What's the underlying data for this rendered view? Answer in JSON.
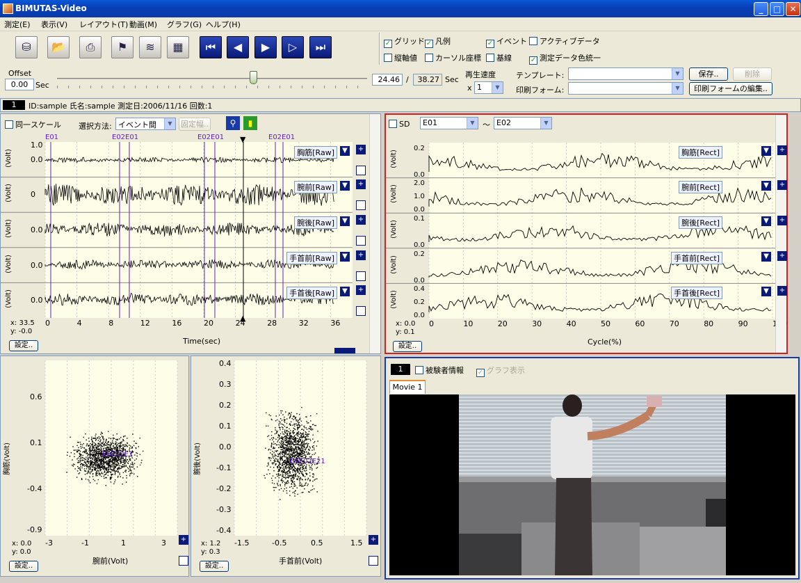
{
  "window": {
    "title": "BIMUTAS-Video",
    "min": "_",
    "max": "□",
    "close": "✕"
  },
  "menu": [
    "測定(E)",
    "表示(V)",
    "レイアウト(T)",
    "動画(M)",
    "グラフ(G)",
    "ヘルプ(H)"
  ],
  "toolbar": {
    "checks": [
      {
        "label": "グリッド",
        "checked": true
      },
      {
        "label": "凡例",
        "checked": true
      },
      {
        "label": "イベント",
        "checked": true
      },
      {
        "label": "アクティブデータ",
        "checked": false
      },
      {
        "label": "縦軸値",
        "checked": false
      },
      {
        "label": "カーソル座標",
        "checked": false
      },
      {
        "label": "基線",
        "checked": false
      },
      {
        "label": "測定データ色統一",
        "checked": true
      }
    ]
  },
  "offset": {
    "label": "Offset",
    "value": "0.00",
    "unit": "Sec",
    "current": "24.46",
    "slash": "/",
    "total": "38.27",
    "unit2": "Sec",
    "speed_label": "再生速度",
    "speed_x": "x",
    "speed_value": "1",
    "template_label": "テンプレート:",
    "print_label": "印刷フォーム:",
    "save": "保存..",
    "delete": "削除",
    "edit_print": "印刷フォームの編集.."
  },
  "info": {
    "num": "1",
    "text": "ID:sample 氏名:sample 測定日:2006/11/16 回数:1"
  },
  "left": {
    "same_scale": "同一スケール",
    "select_label": "選択方法:",
    "select_value": "イベント間",
    "fixed_width": "固定幅..",
    "events": [
      "E01",
      "E02E01",
      "E02E01",
      "E02E01"
    ],
    "channels": [
      {
        "tag": "胸筋[Raw]",
        "ytop": "1.0",
        "ymid": "0.0"
      },
      {
        "tag": "腕前[Raw]",
        "ytop": "",
        "ymid": "0"
      },
      {
        "tag": "腕後[Raw]",
        "ytop": "",
        "ymid": "0.0"
      },
      {
        "tag": "手首前[Raw]",
        "ytop": "",
        "ymid": "0.0"
      },
      {
        "tag": "手首後[Raw]",
        "ytop": "",
        "ymid": "0.0"
      }
    ],
    "unit": "(Volt)",
    "xticks": [
      "0",
      "4",
      "8",
      "12",
      "16",
      "20",
      "24",
      "28",
      "32",
      "36"
    ],
    "xlabel": "Time(sec)",
    "x": "x:  33.5",
    "y": "y:  -0.0",
    "settings": "設定.."
  },
  "right": {
    "sd": "SD",
    "from": "E01",
    "tilde": "〜",
    "to": "E02",
    "channels": [
      {
        "tag": "胸筋[Rect]",
        "ticks": [
          "0.2",
          "0.0"
        ]
      },
      {
        "tag": "腕前[Rect]",
        "ticks": [
          "2.0",
          "1.0",
          "0.0"
        ]
      },
      {
        "tag": "腕後[Rect]",
        "ticks": [
          "0.1",
          "0.0"
        ]
      },
      {
        "tag": "手首前[Rect]",
        "ticks": [
          "0.2",
          "0.0"
        ]
      },
      {
        "tag": "手首後[Rect]",
        "ticks": [
          "0.4",
          "0.2",
          "0.0"
        ]
      }
    ],
    "unit": "(Volt)",
    "xticks": [
      "0",
      "10",
      "20",
      "30",
      "40",
      "50",
      "60",
      "70",
      "80",
      "90",
      "100"
    ],
    "xlabel": "Cycle(%)",
    "x": "x:  0.0",
    "y": "y:  0.1",
    "settings": "設定.."
  },
  "scatter1": {
    "ylabel": "胸筋(Volt)",
    "xlabel": "腕前(Volt)",
    "yticks": [
      "0.6",
      "0.1",
      "-0.4",
      "-0.9"
    ],
    "xticks": [
      "-3",
      "-1",
      "1",
      "3"
    ],
    "x": "x:  0.0",
    "y": "y:  0.0",
    "settings": "設定..",
    "label": "E0E02E1"
  },
  "scatter2": {
    "ylabel": "腕後(Volt)",
    "xlabel": "手首前(Volt)",
    "yticks": [
      "0.4",
      "0.3",
      "0.2",
      "0.1",
      "0.0",
      "-0.1",
      "-0.2",
      "-0.3",
      "-0.4"
    ],
    "xticks": [
      "-1.5",
      "-0.5",
      "0.5",
      "1.5"
    ],
    "x": "x:  1.2",
    "y": "y:  0.3",
    "settings": "設定..",
    "label": "E0E02E21"
  },
  "video": {
    "num": "1",
    "subject": "被験者情報",
    "graph": "グラフ表示",
    "tab": "Movie 1"
  }
}
